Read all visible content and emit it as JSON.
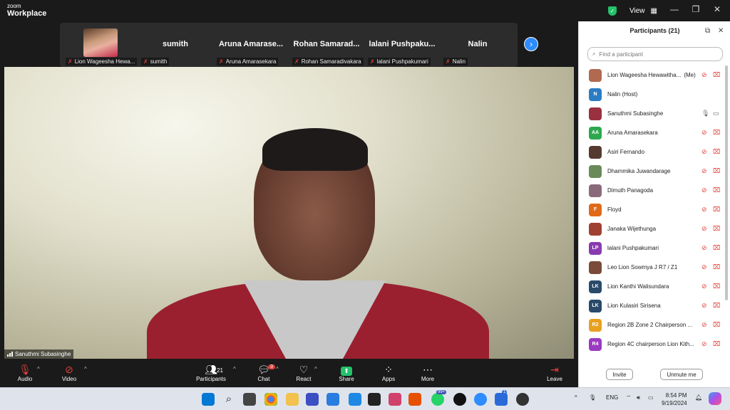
{
  "app": {
    "logo_top": "zoom",
    "logo_bottom": "Workplace"
  },
  "titlebar": {
    "view_label": "View",
    "view_icon": "grid-icon",
    "controls": [
      "minimize-icon",
      "restore-icon",
      "close-icon"
    ]
  },
  "gallery_strip": [
    {
      "display": "",
      "tag": "Lion Wageesha Hewa...",
      "has_photo": true
    },
    {
      "display": "sumith",
      "tag": "sumith"
    },
    {
      "display": "Aruna Amarase...",
      "tag": "Aruna Amarasekara"
    },
    {
      "display": "Rohan Samarad...",
      "tag": "Rohan Samaradivakara"
    },
    {
      "display": "lalani Pushpaku...",
      "tag": "lalani Pushpakumari"
    },
    {
      "display": "Nalin",
      "tag": "Nalin"
    }
  ],
  "active_speaker": {
    "name": "Sanuthmi Subasinghe"
  },
  "toolbar": {
    "audio": "Audio",
    "video": "Video",
    "participants": "Participants",
    "participants_count": "21",
    "chat": "Chat",
    "chat_badge": "3",
    "react": "React",
    "share": "Share",
    "apps": "Apps",
    "more": "More",
    "leave": "Leave"
  },
  "panel": {
    "title": "Participants (21)",
    "search_placeholder": "Find a participant",
    "invite": "Invite",
    "unmute_me": "Unmute me",
    "participants": [
      {
        "name": "Lion Wageesha Hewawitha...",
        "suffix": "(Me)",
        "initials": "",
        "color": "#b06a50",
        "mic": "muted",
        "video": "off"
      },
      {
        "name": "Nalin (Host)",
        "suffix": "",
        "initials": "N",
        "color": "#2c7cc4",
        "mic": "none",
        "video": "none"
      },
      {
        "name": "Sanuthmi Subasinghe",
        "suffix": "",
        "initials": "",
        "color": "#9a3040",
        "mic": "on",
        "video": "on"
      },
      {
        "name": "Aruna Amarasekara",
        "suffix": "",
        "initials": "AA",
        "color": "#2ea84e",
        "mic": "muted",
        "video": "off"
      },
      {
        "name": "Asiri Fernando",
        "suffix": "",
        "initials": "",
        "color": "#553a30",
        "mic": "muted",
        "video": "off"
      },
      {
        "name": "Dhammika Juwandarage",
        "suffix": "",
        "initials": "",
        "color": "#6a8a5a",
        "mic": "muted",
        "video": "off"
      },
      {
        "name": "Dimuth Panagoda",
        "suffix": "",
        "initials": "",
        "color": "#8a6a7a",
        "mic": "muted",
        "video": "off"
      },
      {
        "name": "Floyd",
        "suffix": "",
        "initials": "F",
        "color": "#e06a1a",
        "mic": "muted",
        "video": "off"
      },
      {
        "name": "Janaka Wijethunga",
        "suffix": "",
        "initials": "",
        "color": "#a04030",
        "mic": "muted",
        "video": "off"
      },
      {
        "name": "lalani Pushpakumari",
        "suffix": "",
        "initials": "LP",
        "color": "#8a3ab0",
        "mic": "muted",
        "video": "off"
      },
      {
        "name": "Leo Lion Sowmya J R7 / Z1",
        "suffix": "",
        "initials": "",
        "color": "#7a4a3a",
        "mic": "muted",
        "video": "off"
      },
      {
        "name": "Lion Kanthi Walisundara",
        "suffix": "",
        "initials": "LK",
        "color": "#2a4a6a",
        "mic": "muted",
        "video": "off"
      },
      {
        "name": "Lion Kulasiri Sirisena",
        "suffix": "",
        "initials": "LK",
        "color": "#2a4a6a",
        "mic": "muted",
        "video": "off"
      },
      {
        "name": "Region 2B Zone 2 Chairperson ...",
        "suffix": "",
        "initials": "R2",
        "color": "#e8a020",
        "mic": "muted",
        "video": "off"
      },
      {
        "name": "Region 4C chairperson Lion Kith...",
        "suffix": "",
        "initials": "R4",
        "color": "#9a3ac0",
        "mic": "muted",
        "video": "off"
      }
    ]
  },
  "tray": {
    "language": "ENG",
    "time": "8:54 PM",
    "date": "9/19/2024",
    "whatsapp_badge": "99+",
    "todo_badge": "1"
  }
}
